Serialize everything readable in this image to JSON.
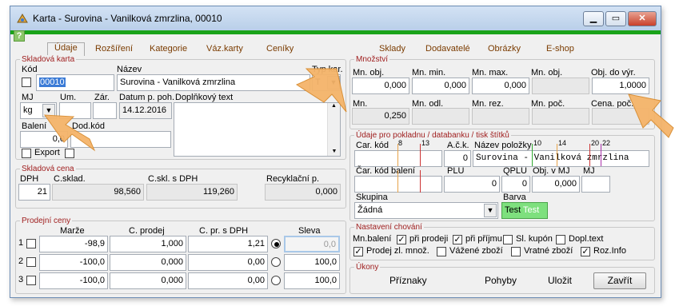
{
  "window": {
    "title": "Karta - Surovina - Vanilková zmrzlina, 00010",
    "help": "?"
  },
  "tabs": [
    "Údaje",
    "Rozšíření",
    "Kategorie",
    "Váz.karty",
    "Ceníky",
    "Sklady",
    "Dodavatelé",
    "Obrázky",
    "E-shop"
  ],
  "skladova_karta": {
    "title": "Skladová karta",
    "kod_label": "Kód",
    "kod": "00010",
    "nazev_label": "Název",
    "nazev": "Surovina - Vanilková zmrzlina",
    "typ_label": "Typ kar.",
    "typ": "T",
    "mj_label": "MJ",
    "mj": "kg",
    "um_label": "Um.",
    "zar_label": "Zár.",
    "datum_label": "Datum p. poh.",
    "datum": "14.12.2016",
    "doplnkovy_label": "Doplňkový text",
    "baleni_label": "Balení",
    "baleni": "0,0",
    "dodkod_label": "Dod.kód",
    "export_label": "Export"
  },
  "mnozstvi": {
    "title": "Množství",
    "labels_row1": [
      "Mn. obj.",
      "Mn. min.",
      "Mn. max.",
      "Mn. obj.",
      "Obj. do výr."
    ],
    "values_row1": [
      "0,000",
      "0,000",
      "0,000",
      "",
      "1,0000"
    ],
    "labels_row2": [
      "Mn.",
      "Mn. odl.",
      "Mn. rez.",
      "Mn. poč.",
      "Cena. poč."
    ],
    "values_row2": [
      "0,250",
      "",
      "",
      "",
      ""
    ]
  },
  "skladova_cena": {
    "title": "Skladová cena",
    "dph_label": "DPH",
    "dph": "21",
    "csklad_label": "C.sklad.",
    "csklad": "98,560",
    "csklsdph_label": "C.skl. s DPH",
    "csklsdph": "119,260",
    "recyk_label": "Recyklační p.",
    "recyk": "0,000"
  },
  "prodejni_ceny": {
    "title": "Prodejní ceny",
    "headers": [
      "Marže",
      "C. prodej",
      "C. pr. s DPH",
      "Sleva"
    ],
    "rows": [
      {
        "n": "1",
        "marze": "-98,9",
        "cprodej": "1,000",
        "cprsdph": "1,21",
        "sleva": "0,0"
      },
      {
        "n": "2",
        "marze": "-100,0",
        "cprodej": "0,000",
        "cprsdph": "0,00",
        "sleva": "100,0"
      },
      {
        "n": "3",
        "marze": "-100,0",
        "cprodej": "0,000",
        "cprsdph": "0,00",
        "sleva": "100,0"
      }
    ]
  },
  "pokladna": {
    "title": "Údaje pro pokladnu / databanku / tisk štítků",
    "car_kod_label": "Car. kód",
    "ack_label": "A.č.k.",
    "ack": "0",
    "nazev_polozky_label": "Název položky",
    "nazev_polozky": "Surovina - Vanilková zmrzlina",
    "ruler_car": [
      "8",
      "13"
    ],
    "ruler_nazev": [
      "10",
      "14",
      "20",
      "22"
    ],
    "car_kod_baleni_label": "Čar. kód balení",
    "plu_label": "PLU",
    "plu": "0",
    "qplu_label": "QPLU",
    "qplu": "0",
    "obj_mj_label": "Obj. v MJ",
    "obj_mj": "0,000",
    "mj_label": "MJ",
    "skupina_label": "Skupina",
    "skupina": "Žádná",
    "barva_label": "Barva",
    "barva_text1": "Test",
    "barva_text2": "Test",
    "barva_color": "#7ee07e"
  },
  "nastaveni": {
    "title": "Nastavení chování",
    "mn_baleni_label": "Mn.balení",
    "items": [
      {
        "label": "při prodeji",
        "checked": true
      },
      {
        "label": "při příjmu",
        "checked": true
      },
      {
        "label": "Sl. kupón",
        "checked": false
      },
      {
        "label": "Dopl.text",
        "checked": false
      },
      {
        "label": "Prodej zl. množ.",
        "checked": true
      },
      {
        "label": "Vážené zboží",
        "checked": false
      },
      {
        "label": "Vratné zboží",
        "checked": false
      },
      {
        "label": "Roz.Info",
        "checked": true
      }
    ]
  },
  "ukony": {
    "title": "Úkony",
    "priznaky": "Příznaky",
    "pohyby": "Pohyby",
    "ulozit": "Uložit",
    "zavrit": "Zavřít"
  },
  "colors": {
    "accent_green": "#1aa31a",
    "group_title": "#a02020",
    "tab_text": "#7a3b00",
    "arrow": "#f2b36a"
  }
}
